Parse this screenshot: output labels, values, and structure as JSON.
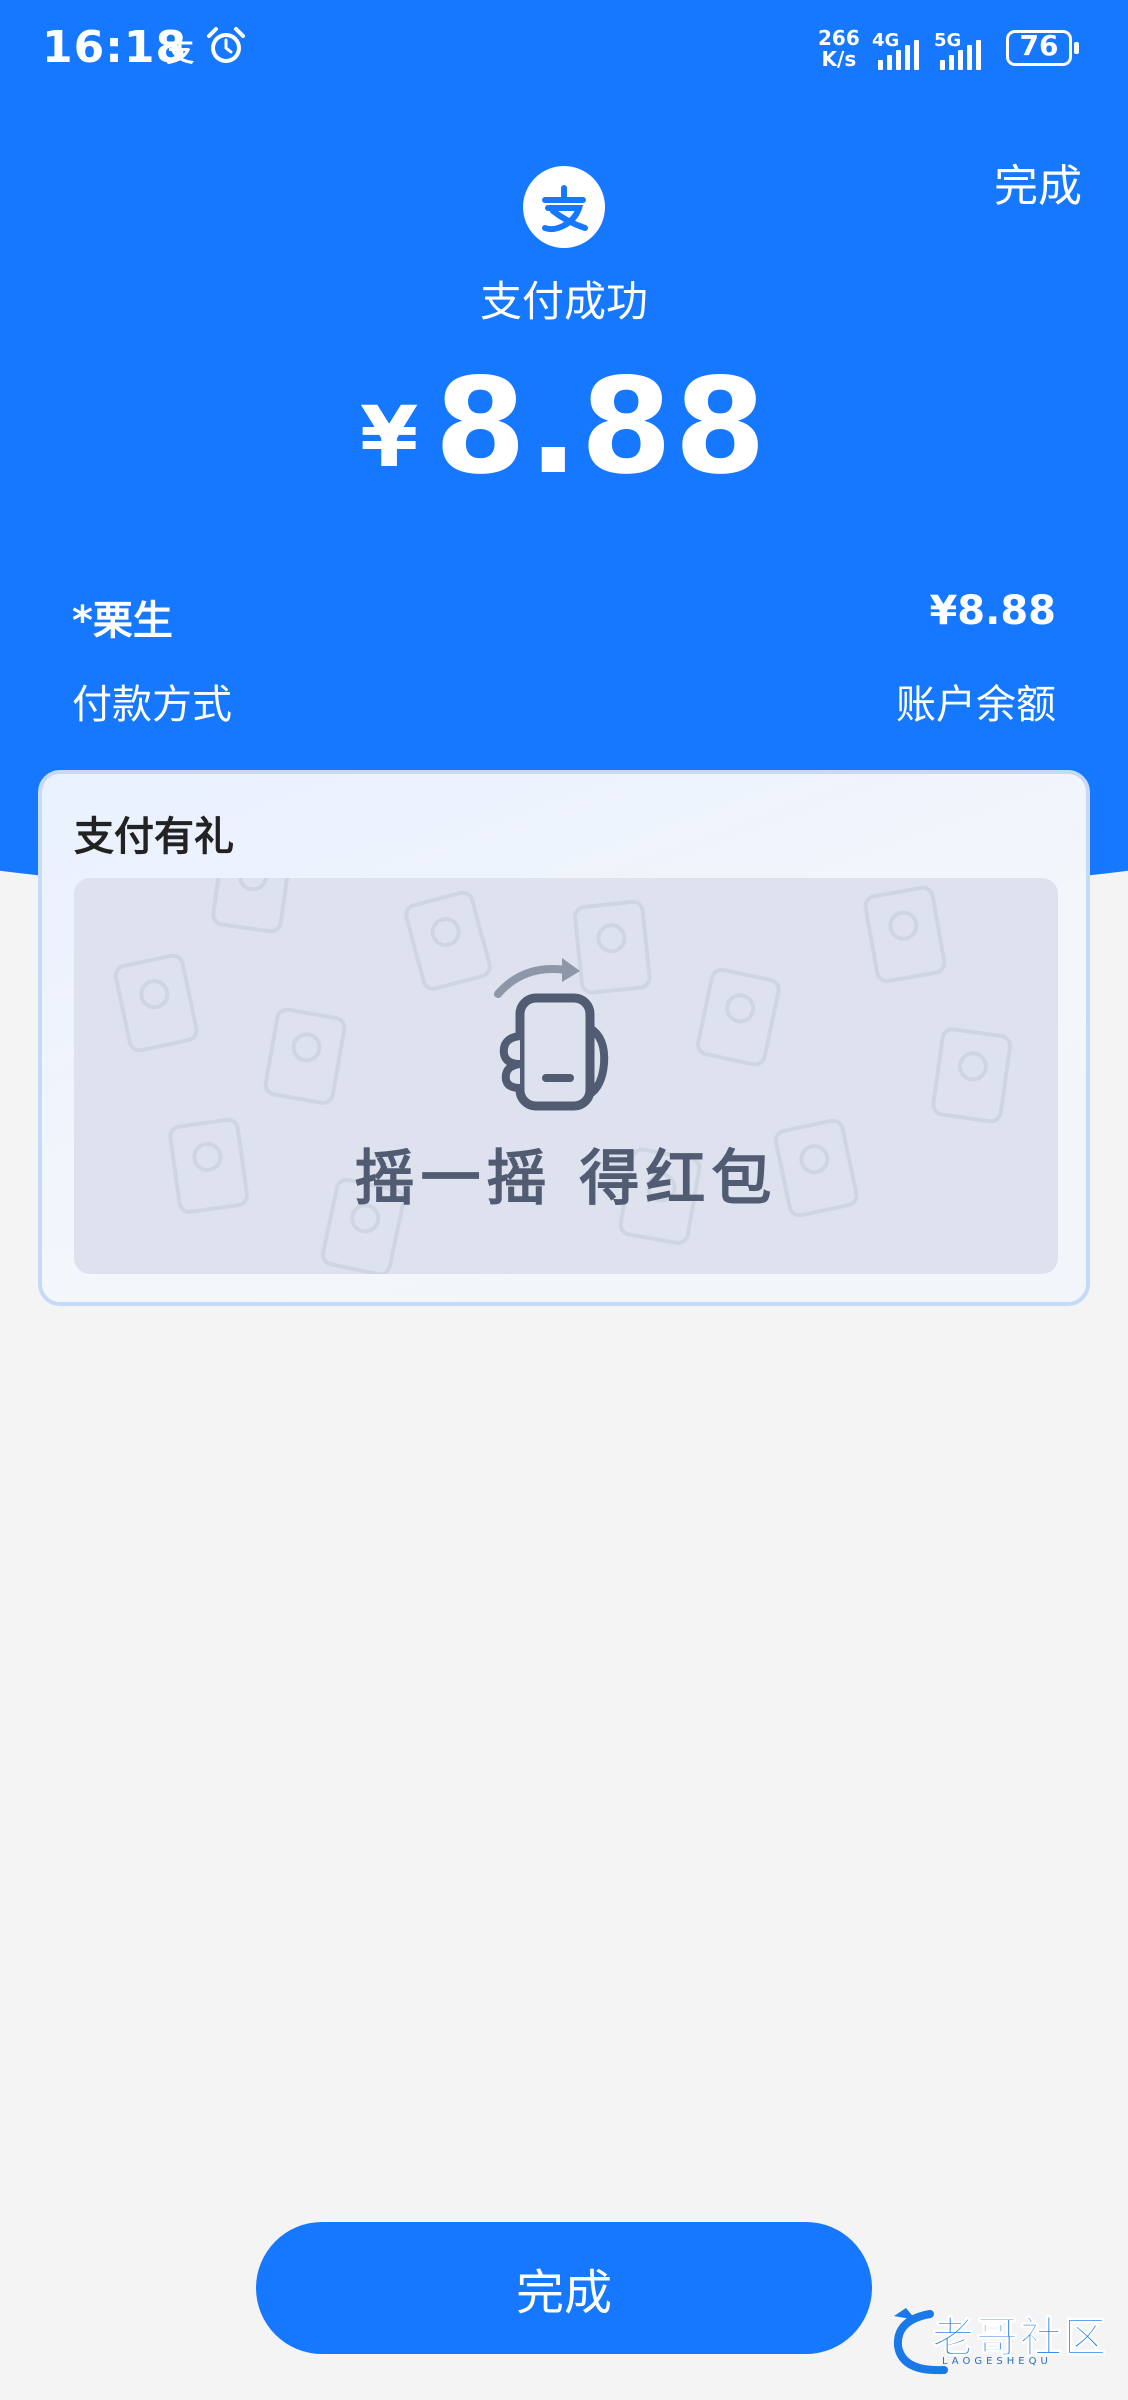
{
  "status_bar": {
    "time": "16:18",
    "alipay_glyph": "支",
    "alarm_icon": "alarm-icon",
    "net_speed_value": "266",
    "net_speed_unit": "K/s",
    "signal_1": "4G",
    "signal_2": "5G",
    "battery": "76"
  },
  "header": {
    "done_label": "完成",
    "logo_glyph": "支",
    "status_text": "支付成功",
    "currency": "¥",
    "amount": "8.88"
  },
  "details": {
    "payee": "*栗生",
    "payee_amount": "¥8.88",
    "method_label": "付款方式",
    "method_value": "账户余额"
  },
  "gift": {
    "title": "支付有礼",
    "action_text": "摇一摇 得红包",
    "icon": "shake-phone-icon"
  },
  "footer": {
    "done_button_label": "完成"
  },
  "watermark": {
    "text": "老哥社区",
    "sub": "LAOGESHEQU"
  },
  "colors": {
    "primary": "#1677ff",
    "background": "#f4f4f5",
    "card_border": "#c5daf6"
  }
}
